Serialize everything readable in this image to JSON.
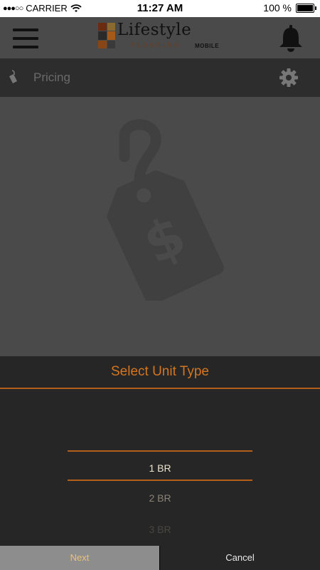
{
  "status_bar": {
    "signal": "●●●○○",
    "carrier": "CARRIER",
    "time": "11:27 AM",
    "battery": "100 %"
  },
  "header": {
    "logo_main": "Lifestyle",
    "logo_sub": "FLOORING",
    "logo_mobile": "MOBILE",
    "menu_icon": "hamburger-menu-icon",
    "notification_icon": "bell-icon"
  },
  "section": {
    "title": "Pricing",
    "icon": "price-tag-icon",
    "settings_icon": "gear-icon"
  },
  "hero": {
    "icon": "dollar-price-tag-icon"
  },
  "picker": {
    "title": "Select Unit Type",
    "options": [
      "1 BR",
      "2 BR",
      "3 BR"
    ],
    "selected": "1 BR"
  },
  "buttons": {
    "next": "Next",
    "cancel": "Cancel"
  },
  "colors": {
    "accent": "#d4761f",
    "divider": "#b35f1c",
    "panel": "#262626",
    "hero_bg": "#4a4a4a"
  }
}
